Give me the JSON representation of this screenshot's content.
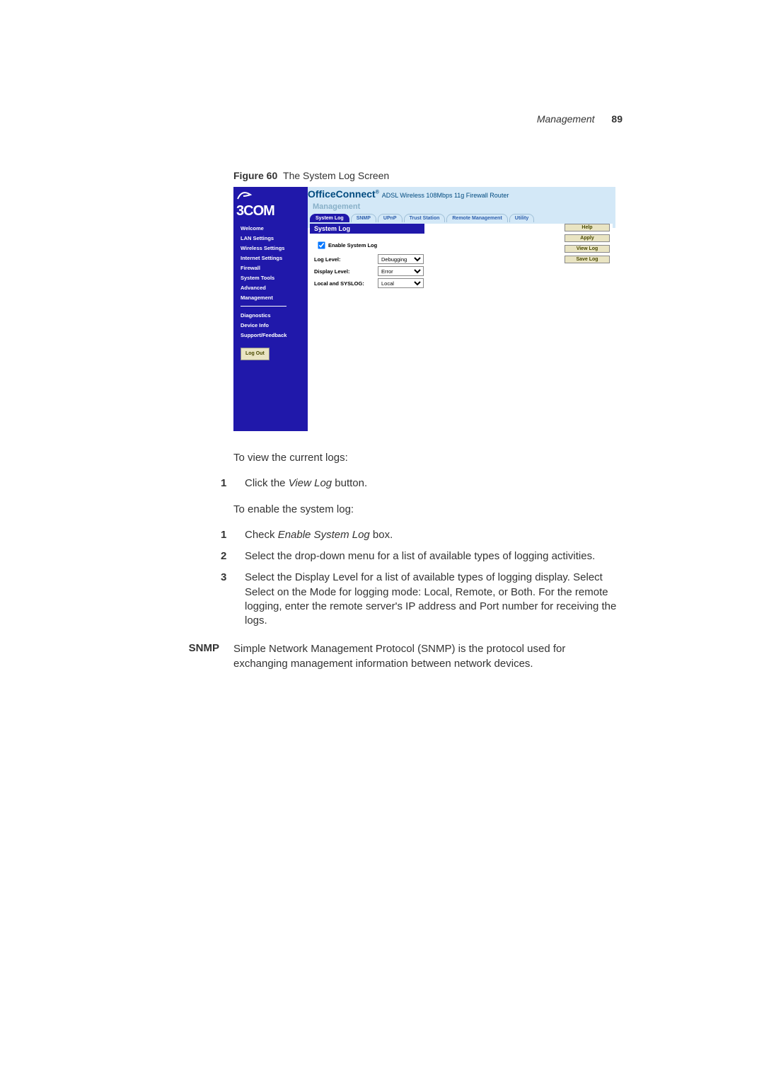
{
  "running_head": {
    "title": "Management",
    "page": "89"
  },
  "figure": {
    "label": "Figure 60",
    "caption": "The System Log Screen"
  },
  "shot": {
    "brand": "3COM",
    "banner_main": "OfficeConnect",
    "banner_tail": "ADSL  Wireless  108Mbps  11g  Firewall Router",
    "subtitle": "Management",
    "nav": {
      "items": [
        "Welcome",
        "LAN Settings",
        "Wireless Settings",
        "Internet Settings",
        "Firewall",
        "System Tools",
        "Advanced",
        "Management"
      ],
      "items2": [
        "Diagnostics",
        "Device Info",
        "Support/Feedback"
      ],
      "logout": "Log Out"
    },
    "tabs": [
      "System Log",
      "SNMP",
      "UPnP",
      "Trust Station",
      "Remote Management",
      "Utility"
    ],
    "panel_title": "System Log",
    "form": {
      "enable_cb": true,
      "enable_label": "Enable System Log",
      "row1_label": "Log Level:",
      "row1_value": "Debugging",
      "row2_label": "Display Level:",
      "row2_value": "Error",
      "row3_label": "Local and SYSLOG:",
      "row3_value": "Local"
    },
    "sidebtns": [
      "Help",
      "Apply",
      "View Log",
      "Save Log"
    ]
  },
  "body": {
    "p_view": "To view the current logs:",
    "list_view": [
      "Click the <em>View Log</em> button."
    ],
    "p_enable": "To enable the system log:",
    "list_enable": [
      "Check <em>Enable System Log</em> box.",
      "Select the drop-down menu for a list of available types of logging activities.",
      "Select the Display Level for a list of available types of logging display. Select Select on the Mode for logging mode: Local, Remote, or Both. For the remote logging, enter the remote server's IP address and Port number for receiving the logs."
    ]
  },
  "snmp": {
    "label": "SNMP",
    "text": "Simple Network Management Protocol (SNMP) is the protocol used for exchanging management information between network devices."
  }
}
